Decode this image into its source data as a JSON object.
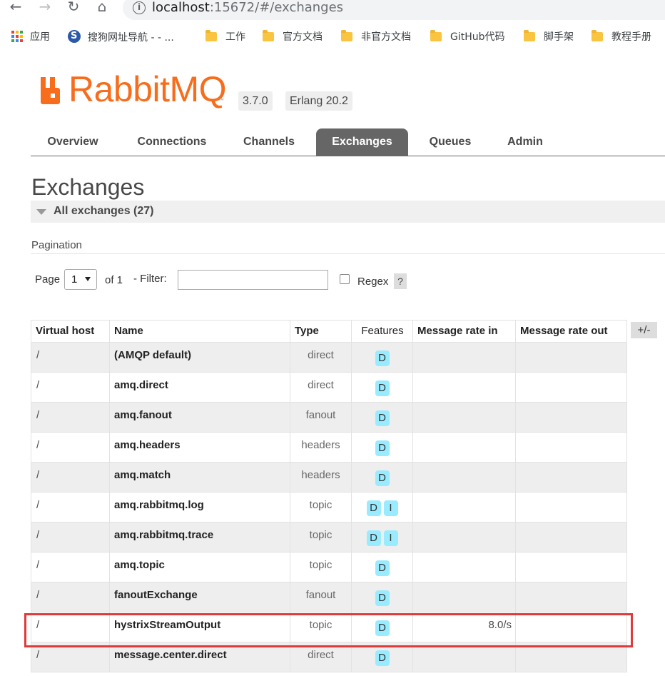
{
  "browser": {
    "url_host": "localhost",
    "url_rest": ":15672/#/exchanges",
    "bookmarks": [
      {
        "label": "应用",
        "icon": "apps-icon"
      },
      {
        "label": "搜狗网址导航 - - ...",
        "icon": "sogou-icon"
      },
      {
        "label": "工作",
        "icon": "folder-icon"
      },
      {
        "label": "官方文档",
        "icon": "folder-icon"
      },
      {
        "label": "非官方文档",
        "icon": "folder-icon"
      },
      {
        "label": "GitHub代码",
        "icon": "folder-icon"
      },
      {
        "label": "脚手架",
        "icon": "folder-icon"
      },
      {
        "label": "教程手册",
        "icon": "folder-icon"
      }
    ]
  },
  "header": {
    "logo_text_rabbit": "Rabbit",
    "logo_text_mq": "MQ",
    "logo_tm": "™",
    "version": "3.7.0",
    "erlang": "Erlang 20.2",
    "brand_color": "#f76d1b"
  },
  "tabs": [
    {
      "label": "Overview"
    },
    {
      "label": "Connections"
    },
    {
      "label": "Channels"
    },
    {
      "label": "Exchanges",
      "active": true
    },
    {
      "label": "Queues"
    },
    {
      "label": "Admin"
    }
  ],
  "page": {
    "title": "Exchanges",
    "section_label": "All exchanges (27)",
    "pagination_label": "Pagination",
    "page_label": "Page",
    "page_value": "1",
    "of_label": "of 1",
    "filter_label": "- Filter:",
    "filter_value": "",
    "regex_label": "Regex",
    "help_label": "?",
    "columns_toggle": "+/-"
  },
  "table": {
    "headers": {
      "vhost": "Virtual host",
      "name": "Name",
      "type": "Type",
      "features": "Features",
      "rate_in": "Message rate in",
      "rate_out": "Message rate out"
    },
    "rows": [
      {
        "vhost": "/",
        "name": "(AMQP default)",
        "type": "direct",
        "features": [
          "D"
        ],
        "rate_in": "",
        "rate_out": ""
      },
      {
        "vhost": "/",
        "name": "amq.direct",
        "type": "direct",
        "features": [
          "D"
        ],
        "rate_in": "",
        "rate_out": ""
      },
      {
        "vhost": "/",
        "name": "amq.fanout",
        "type": "fanout",
        "features": [
          "D"
        ],
        "rate_in": "",
        "rate_out": ""
      },
      {
        "vhost": "/",
        "name": "amq.headers",
        "type": "headers",
        "features": [
          "D"
        ],
        "rate_in": "",
        "rate_out": ""
      },
      {
        "vhost": "/",
        "name": "amq.match",
        "type": "headers",
        "features": [
          "D"
        ],
        "rate_in": "",
        "rate_out": ""
      },
      {
        "vhost": "/",
        "name": "amq.rabbitmq.log",
        "type": "topic",
        "features": [
          "D",
          "I"
        ],
        "rate_in": "",
        "rate_out": ""
      },
      {
        "vhost": "/",
        "name": "amq.rabbitmq.trace",
        "type": "topic",
        "features": [
          "D",
          "I"
        ],
        "rate_in": "",
        "rate_out": ""
      },
      {
        "vhost": "/",
        "name": "amq.topic",
        "type": "topic",
        "features": [
          "D"
        ],
        "rate_in": "",
        "rate_out": ""
      },
      {
        "vhost": "/",
        "name": "fanoutExchange",
        "type": "fanout",
        "features": [
          "D"
        ],
        "rate_in": "",
        "rate_out": ""
      },
      {
        "vhost": "/",
        "name": "hystrixStreamOutput",
        "type": "topic",
        "features": [
          "D"
        ],
        "rate_in": "8.0/s",
        "rate_out": ""
      },
      {
        "vhost": "/",
        "name": "message.center.direct",
        "type": "direct",
        "features": [
          "D"
        ],
        "rate_in": "",
        "rate_out": ""
      }
    ]
  }
}
